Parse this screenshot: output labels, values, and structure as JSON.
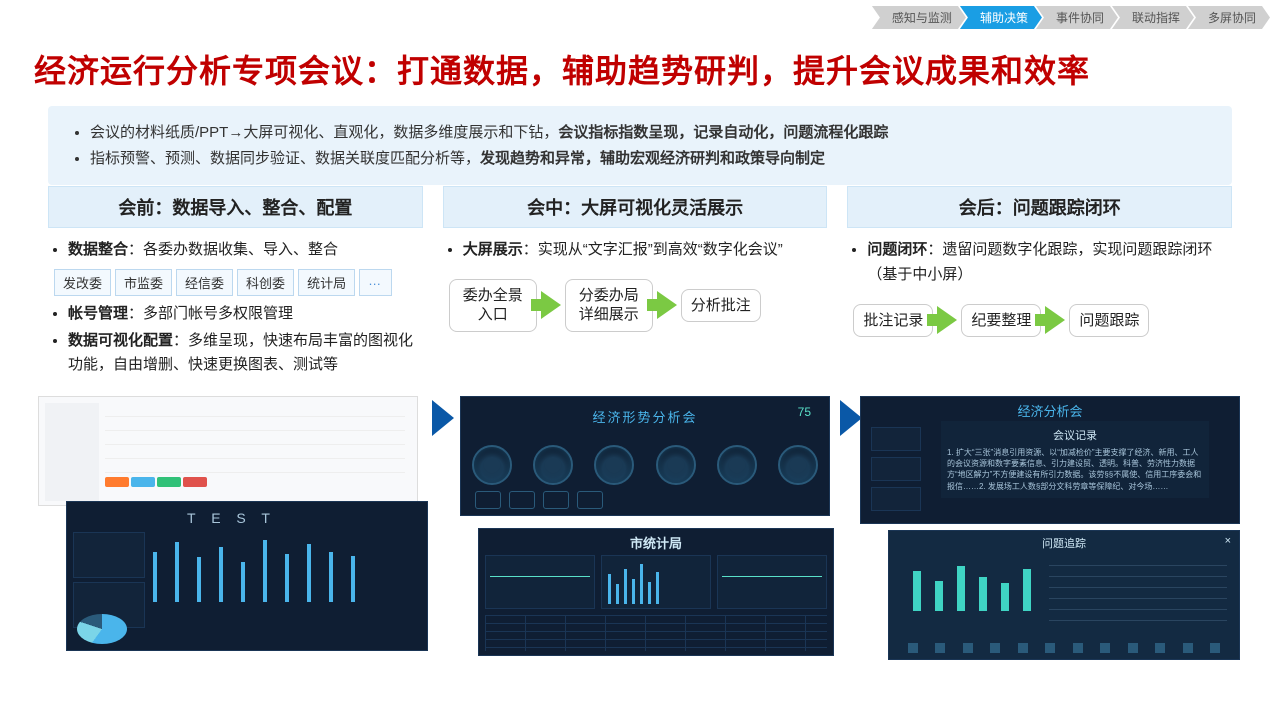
{
  "breadcrumbs": {
    "items": [
      "感知与监测",
      "辅助决策",
      "事件协同",
      "联动指挥",
      "多屏协同"
    ],
    "active_index": 1
  },
  "title": "经济运行分析专项会议：打通数据，辅助趋势研判，提升会议成果和效率",
  "intro": {
    "line1_pre": "会议的材料纸质/PPT→大屏可视化、直观化，数据多维度展示和下钻，",
    "line1_bold": "会议指标指数呈现，记录自动化，问题流程化跟踪",
    "line2_pre": "指标预警、预测、数据同步验证、数据关联度匹配分析等，",
    "line2_bold": "发现趋势和异常，辅助宏观经济研判和政策导向制定"
  },
  "col1": {
    "header": "会前：数据导入、整合、配置",
    "bullet1_b": "数据整合",
    "bullet1_rest": "：各委办数据收集、导入、整合",
    "dept_tags": [
      "发改委",
      "市监委",
      "经信委",
      "科创委",
      "统计局"
    ],
    "dept_more": "…",
    "bullet2_b": "帐号管理",
    "bullet2_rest": "：多部门帐号多权限管理",
    "bullet3_b": "数据可视化配置",
    "bullet3_rest": "：多维呈现，快速布局丰富的图视化功能，自由增删、快速更换图表、测试等"
  },
  "col2": {
    "header": "会中：大屏可视化灵活展示",
    "bullet1_b": "大屏展示",
    "bullet1_rest": "：实现从“文字汇报”到高效“数字化会议”",
    "flow": [
      "委办全景入口",
      "分委办局详细展示",
      "分析批注"
    ]
  },
  "col3": {
    "header": "会后：问题跟踪闭环",
    "bullet1_b": "问题闭环",
    "bullet1_rest": "：遗留问题数字化跟踪，实现问题跟踪闭环（基于中小屏）",
    "flow": [
      "批注记录",
      "纪要整理",
      "问题跟踪"
    ]
  },
  "mocks": {
    "m1_bottom_title": "T E S T",
    "m2_top_title": "经济形势分析会",
    "m2_top_score": "75",
    "m2_bottom_title": "市统计局",
    "m3_top_title": "经济分析会",
    "m3_memo_title": "会议记录",
    "m3_memo_body": "1. 扩大“三张”消息引用资源、以“加减检价”主要支撑了经济、新用、工人的会议资源和数字要素信息、引力建设贸、透明。科普、劳济性力数据方“地区解力”不方便建设有所引力数据。该劳§§不属使、信用工序委会和报信……2. 发展场工人数§部分文科劳章等保障纪、对今场……",
    "m3_bottom_title": "问题追踪",
    "close": "×"
  }
}
